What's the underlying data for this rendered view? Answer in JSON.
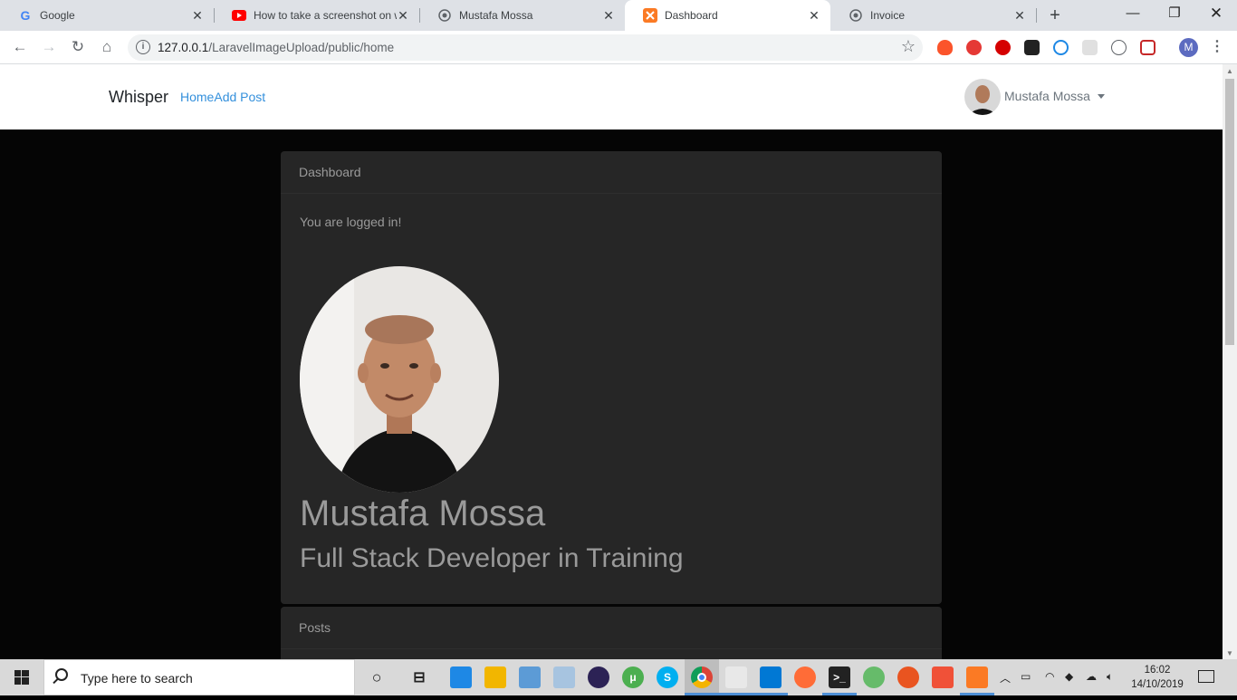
{
  "browser": {
    "tabs": [
      {
        "title": "Google",
        "favicon": "google-g-icon"
      },
      {
        "title": "How to take a screenshot on w",
        "favicon": "youtube-icon"
      },
      {
        "title": "Mustafa Mossa",
        "favicon": "globe-icon"
      },
      {
        "title": "Dashboard",
        "favicon": "xampp-icon"
      },
      {
        "title": "Invoice",
        "favicon": "globe-icon"
      }
    ],
    "close_glyph": "✕",
    "new_tab_glyph": "+",
    "address": {
      "host": "127.0.0.1",
      "path": "/LaravelImageUpload/public/home"
    },
    "profile_initial": "M"
  },
  "app": {
    "brand": "Whisper",
    "nav_links": [
      "Home",
      "Add Post"
    ],
    "user_name": "Mustafa Mossa"
  },
  "dashboard": {
    "header": "Dashboard",
    "status": "You are logged in!",
    "name": "Mustafa Mossa",
    "role": "Full Stack Developer in Training"
  },
  "posts": {
    "header": "Posts"
  },
  "taskbar": {
    "search_placeholder": "Type here to search",
    "time": "16:02",
    "date": "14/10/2019"
  },
  "colors": {
    "link": "#3490dc",
    "card": "#262626",
    "page_bg": "#050505"
  }
}
